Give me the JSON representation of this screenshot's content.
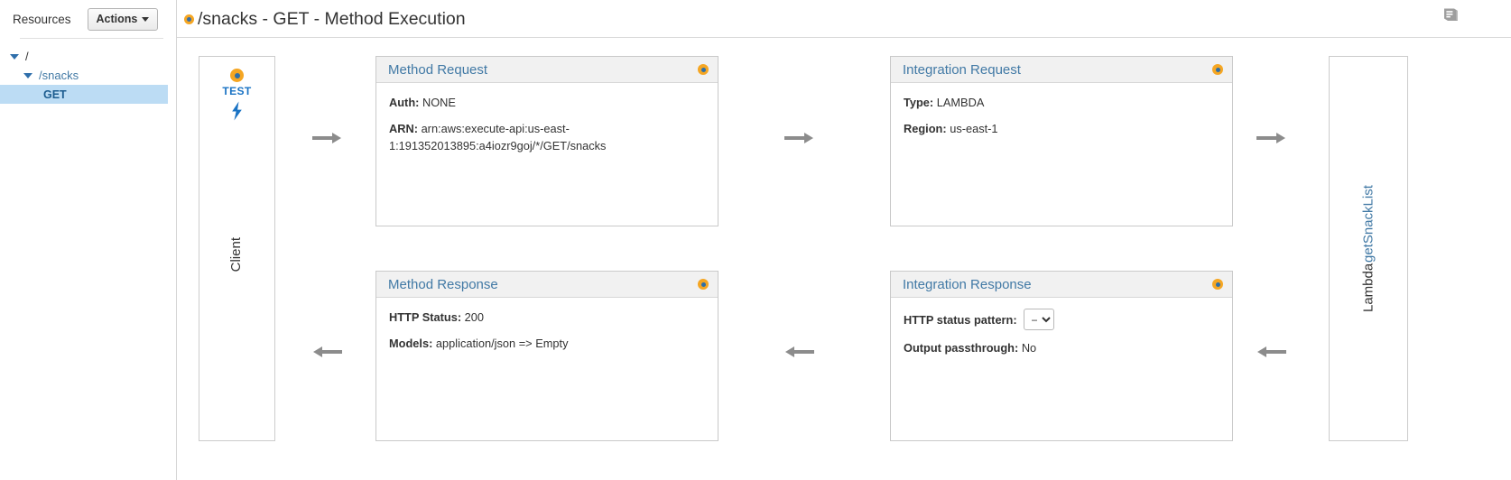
{
  "sidebar": {
    "title": "Resources",
    "actions_button": "Actions",
    "tree": [
      {
        "label": "/",
        "level": 1,
        "expanded": true,
        "selected": false,
        "style": "root"
      },
      {
        "label": "/snacks",
        "level": 2,
        "expanded": true,
        "selected": false,
        "style": "link"
      },
      {
        "label": "GET",
        "level": 3,
        "expanded": false,
        "selected": true,
        "style": "selected"
      }
    ]
  },
  "header": {
    "title": "/snacks - GET - Method Execution",
    "status_dot_color": "#f5a623",
    "doc_icon": "book-icon"
  },
  "client": {
    "test_label": "TEST",
    "bolt_icon": "lightning-bolt-icon",
    "vertical_label": "Client"
  },
  "lambda": {
    "prefix": "Lambda ",
    "function_name": "getSnackList"
  },
  "panels": {
    "method_request": {
      "title": "Method Request",
      "rows": [
        {
          "key": "Auth:",
          "value": "NONE"
        },
        {
          "key": "ARN:",
          "value": "arn:aws:execute-api:us-east-1:191352013895:a4iozr9goj/*/GET/snacks"
        }
      ]
    },
    "integration_request": {
      "title": "Integration Request",
      "rows": [
        {
          "key": "Type:",
          "value": "LAMBDA"
        },
        {
          "key": "Region:",
          "value": "us-east-1"
        }
      ]
    },
    "method_response": {
      "title": "Method Response",
      "rows": [
        {
          "key": "HTTP Status:",
          "value": "200"
        },
        {
          "key": "Models:",
          "value": "application/json => Empty"
        }
      ]
    },
    "integration_response": {
      "title": "Integration Response",
      "status_pattern_label": "HTTP status pattern:",
      "status_pattern_value": "–",
      "status_pattern_options": [
        "–"
      ],
      "rows": [
        {
          "key": "Output passthrough:",
          "value": "No"
        }
      ]
    }
  },
  "colors": {
    "accent_blue": "#4179a5",
    "status_orange": "#f5a623",
    "selection_blue": "#bcdcf4",
    "arrow_gray": "#8c8c8c"
  }
}
